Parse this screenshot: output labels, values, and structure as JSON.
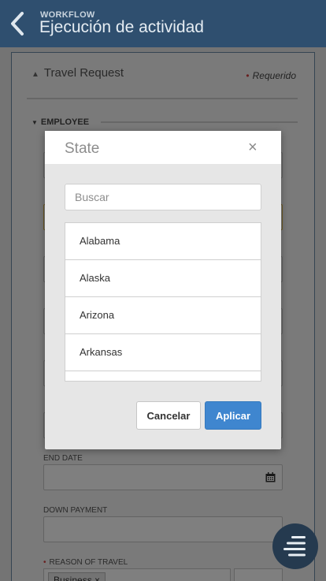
{
  "header": {
    "subtitle": "WORKFLOW",
    "title": "Ejecución de actividad",
    "back_icon": "chevron-left-icon"
  },
  "form": {
    "section_title": "Travel Request",
    "required_label": "Requerido",
    "group_title": "EMPLOYEE",
    "end_date_label": "END DATE",
    "down_payment_label": "DOWN PAYMENT",
    "reason_label": "REASON OF TRAVEL",
    "reason_chip": "Business ×"
  },
  "modal": {
    "title": "State",
    "close_symbol": "×",
    "search_placeholder": "Buscar",
    "options": [
      "Alabama",
      "Alaska",
      "Arizona",
      "Arkansas",
      ""
    ],
    "cancel_label": "Cancelar",
    "apply_label": "Aplicar"
  },
  "colors": {
    "header_bg": "#2f4f6f",
    "accent": "#3f86cf",
    "required": "#d24141",
    "fab_bg": "#253a4f"
  }
}
